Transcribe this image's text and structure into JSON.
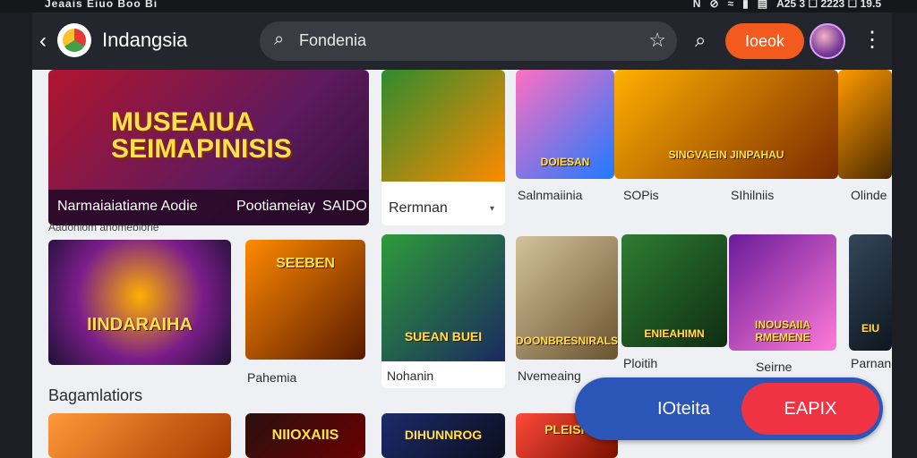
{
  "statusbar": {
    "left_text": "Jeaais Eiuo Boo Bi",
    "icons": [
      "N",
      "⊘",
      "≈",
      "▮",
      "▤"
    ],
    "right_text": "A25 3 ☐ 2223 ☐ 19.5"
  },
  "appbar": {
    "back_icon": "chevron-left-icon",
    "app_title": "Indangsia",
    "search_text": "Fondenia",
    "orange_button": "Ioeok",
    "icons": [
      "search-icon",
      "star-icon",
      "more-icon"
    ]
  },
  "banner": {
    "title": "MUSEAIUA SEIMAPINISIS",
    "foot_left": "Narmaiaiatiame Aodie",
    "foot_middle": "Pootiameiay",
    "foot_right": "SAIDO"
  },
  "top_cards": {
    "card1": {
      "caption": "Rermnan"
    },
    "card2": {
      "caption": "Salnmaiinia"
    },
    "card3": {
      "caption": "SOPis"
    },
    "card4": {
      "caption": "SIhilniis"
    },
    "card5": {
      "caption": "Olinde"
    }
  },
  "section_small": "Aadoniom anomeblorie",
  "middle_cards": {
    "card1": {
      "caption": "",
      "label": "IINDARAIHA"
    },
    "card2": {
      "caption": "Pahemia",
      "label": "SEEBEN"
    },
    "card3": {
      "caption": "Nohanin",
      "label": "SUEAN BUEI"
    },
    "card4": {
      "caption": "Nvemeaing",
      "label": "DOONBRESNIRALS"
    },
    "card5": {
      "caption": "Ploitih",
      "label": "ENIEAHIMN"
    },
    "card6": {
      "caption": "Seirne",
      "label": "INOUSAIIA RMEMENE"
    },
    "card7": {
      "caption": "Parnan",
      "label": "EIU"
    }
  },
  "section_title": "Bagamlatiors",
  "bottom_cards": {
    "card1": {
      "caption": ""
    },
    "card2": {
      "label": "NIIOXAIIS"
    },
    "card3": {
      "label": "DIHUNNROG"
    },
    "card4": {
      "label": "PLEISP"
    }
  },
  "promo": {
    "left_text": "IOteita",
    "right_text": "EAPIX"
  },
  "colors": {
    "appbar": "#24262d",
    "promo_blue": "#2b55b6",
    "promo_red": "#ef3343",
    "accent_orange": "#f25a1e"
  }
}
